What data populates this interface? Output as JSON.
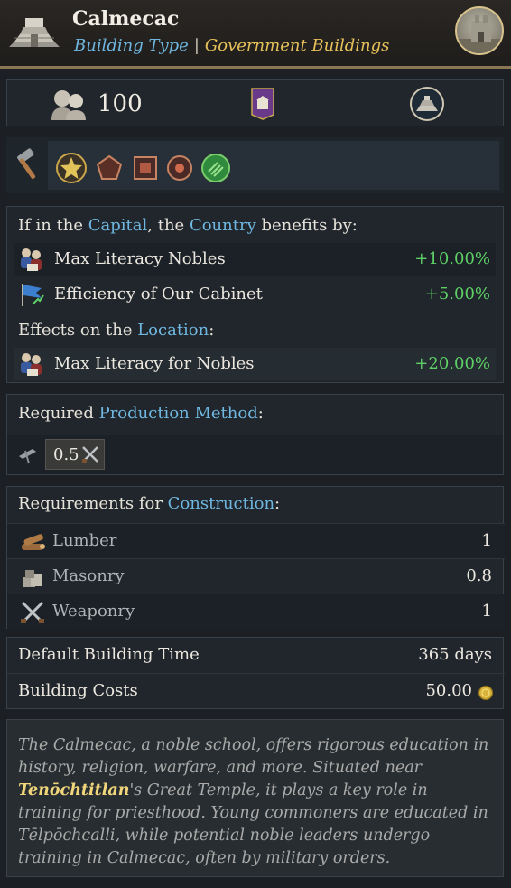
{
  "header": {
    "title": "Calmecac",
    "building_type_label": "Building Type",
    "separator": "|",
    "category": "Government Buildings"
  },
  "stats": {
    "population_value": "100"
  },
  "country_effects": {
    "heading_prefix": "If in the ",
    "heading_capital": "Capital",
    "heading_mid": ", the ",
    "heading_country": "Country",
    "heading_suffix": " benefits by:",
    "items": [
      {
        "label": "Max Literacy Nobles",
        "value": "+10.00%",
        "icon": "nobles-icon"
      },
      {
        "label": "Efficiency of Our Cabinet",
        "value": "+5.00%",
        "icon": "cabinet-flag-icon"
      }
    ]
  },
  "location_effects": {
    "heading_prefix": "Effects on the ",
    "heading_location": "Location",
    "heading_suffix": ":",
    "items": [
      {
        "label": "Max Literacy for Nobles",
        "value": "+20.00%",
        "icon": "nobles-icon"
      }
    ]
  },
  "production": {
    "heading_prefix": "Required ",
    "heading_link": "Production Method",
    "heading_suffix": ":",
    "method_value": "0.5"
  },
  "construction": {
    "heading_prefix": "Requirements for ",
    "heading_link": "Construction",
    "heading_suffix": ":",
    "items": [
      {
        "label": "Lumber",
        "value": "1",
        "icon": "lumber-icon"
      },
      {
        "label": "Masonry",
        "value": "0.8",
        "icon": "masonry-icon"
      },
      {
        "label": "Weaponry",
        "value": "1",
        "icon": "weaponry-icon"
      }
    ]
  },
  "building_info": {
    "time_label": "Default Building Time",
    "time_value": "365 days",
    "cost_label": "Building Costs",
    "cost_value": "50.00"
  },
  "description": {
    "part1": "The Calmecac, a noble school, offers rigorous education in history, religion, warfare, and more. Situated near ",
    "highlight": "Tenōchtitlan",
    "part2": "'s Great Temple, it plays a key role in training for priesthood. Young commoners are educated in Tēlpōchcalli, while potential noble leaders undergo training in Calmecac, often by military orders."
  },
  "colors": {
    "link_blue": "#6fb7e0",
    "gold": "#e6c15a",
    "positive_green": "#5ed066",
    "header_border": "#8a7653"
  }
}
